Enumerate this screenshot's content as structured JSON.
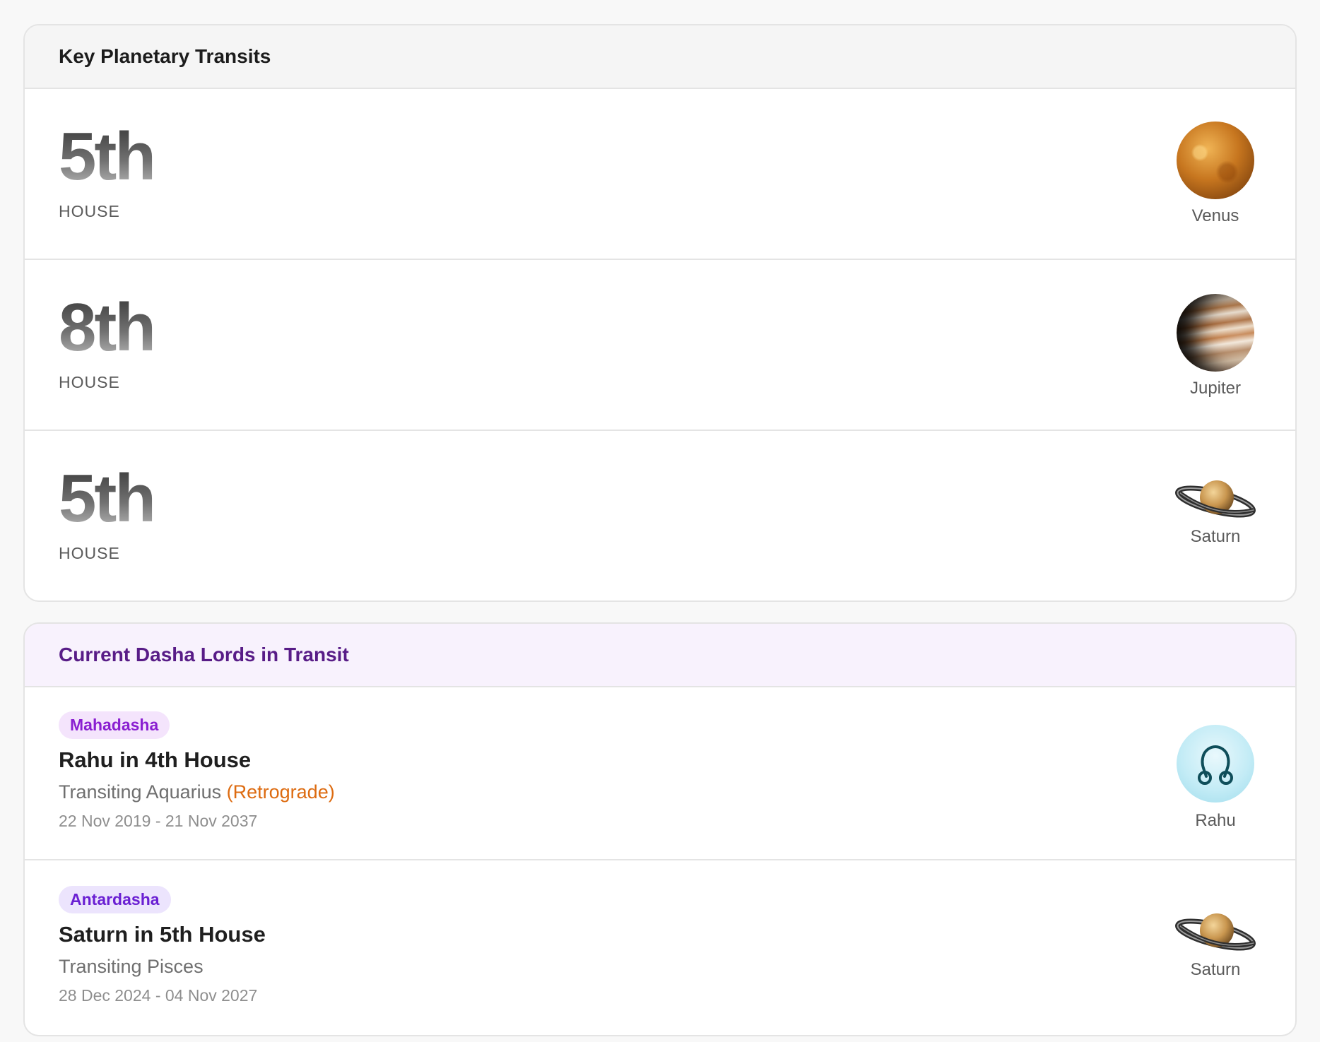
{
  "transits": {
    "title": "Key Planetary Transits",
    "rows": [
      {
        "house": "5th",
        "house_label": "HOUSE",
        "planet": "Venus",
        "icon": "venus-icon"
      },
      {
        "house": "8th",
        "house_label": "HOUSE",
        "planet": "Jupiter",
        "icon": "jupiter-icon"
      },
      {
        "house": "5th",
        "house_label": "HOUSE",
        "planet": "Saturn",
        "icon": "saturn-icon"
      }
    ]
  },
  "dasha": {
    "title": "Current Dasha Lords in Transit",
    "rows": [
      {
        "badge": "Mahadasha",
        "title": "Rahu in 4th House",
        "sign": "Transiting Aquarius",
        "retrograde": "(Retrograde)",
        "period": "22 Nov 2019 - 21 Nov 2037",
        "planet": "Rahu",
        "icon": "rahu-icon"
      },
      {
        "badge": "Antardasha",
        "title": "Saturn in 5th House",
        "sign": "Transiting Pisces",
        "period": "28 Dec 2024 - 04 Nov 2027",
        "planet": "Saturn",
        "icon": "saturn-icon"
      }
    ]
  },
  "colors": {
    "dasha_header_text": "#581c87",
    "retrograde": "#dd6b10",
    "mahadasha_badge": "#8a1fd1",
    "antardasha_badge": "#6a1fd3"
  }
}
